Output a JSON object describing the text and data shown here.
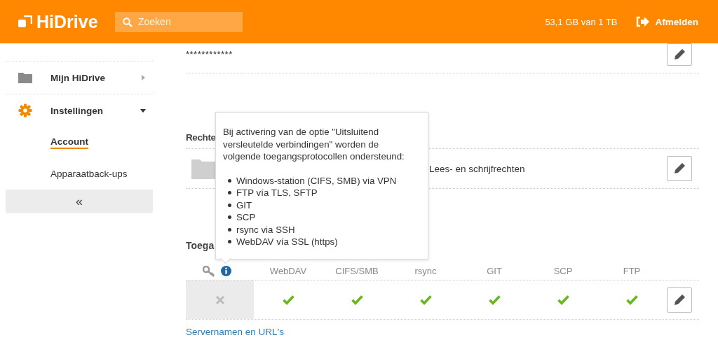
{
  "header": {
    "logo": "HiDrive",
    "search": {
      "placeholder": "Zoeken"
    },
    "storage": "53,1 GB van 1 TB",
    "logout": "Afmelden"
  },
  "sidebar": {
    "items": [
      {
        "label": "Mijn HiDrive",
        "expanded": false
      },
      {
        "label": "Instellingen",
        "expanded": true,
        "children": [
          {
            "label": "Account",
            "selected": true
          },
          {
            "label": "Apparaatback-ups",
            "selected": false
          }
        ]
      }
    ],
    "collapse": "«"
  },
  "main": {
    "password": "************",
    "rights": {
      "heading": "Rechte",
      "permission": "Lees- en schrijfrechten"
    },
    "access": {
      "heading": "Toega",
      "columns": [
        "WebDAV",
        "CIFS/SMB",
        "rsync",
        "GIT",
        "SCP",
        "FTP"
      ],
      "encrypted_only": false,
      "protocols": [
        {
          "supported": true
        },
        {
          "supported": true
        },
        {
          "supported": true
        },
        {
          "supported": true
        },
        {
          "supported": true
        },
        {
          "supported": true
        }
      ]
    },
    "link": "Servernamen en URL's"
  },
  "tooltip": {
    "intro": "Bij activering van de optie \"Uitsluitend versleutelde verbindingen\" worden de volgende toegangsprotocollen ondersteund:",
    "items": [
      "Windows-station (CIFS, SMB) via VPN",
      "FTP vía TLS, SFTP",
      "GIT",
      "SCP",
      "rsync via SSH",
      "WebDAV vía SSL (https)"
    ]
  }
}
